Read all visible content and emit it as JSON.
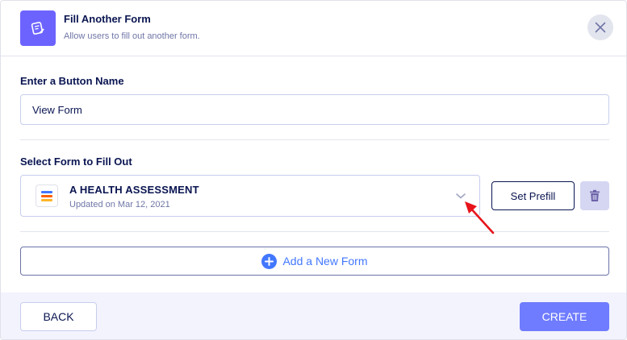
{
  "header": {
    "title": "Fill Another Form",
    "subtitle": "Allow users to fill out another form.",
    "icon": "form-edit-icon",
    "accent": "#6c63ff"
  },
  "button_name": {
    "label": "Enter a Button Name",
    "value": "View Form"
  },
  "form_select": {
    "label": "Select Form to Fill Out",
    "form_title": "A HEALTH ASSESSMENT",
    "updated": "Updated on Mar 12, 2021",
    "set_prefill_label": "Set Prefill"
  },
  "add_form": {
    "label": "Add a New Form",
    "color": "#4277ff"
  },
  "footer": {
    "back_label": "BACK",
    "create_label": "CREATE",
    "create_color": "#6f7cff"
  },
  "annotation": {
    "arrow_color": "#e8141b"
  }
}
